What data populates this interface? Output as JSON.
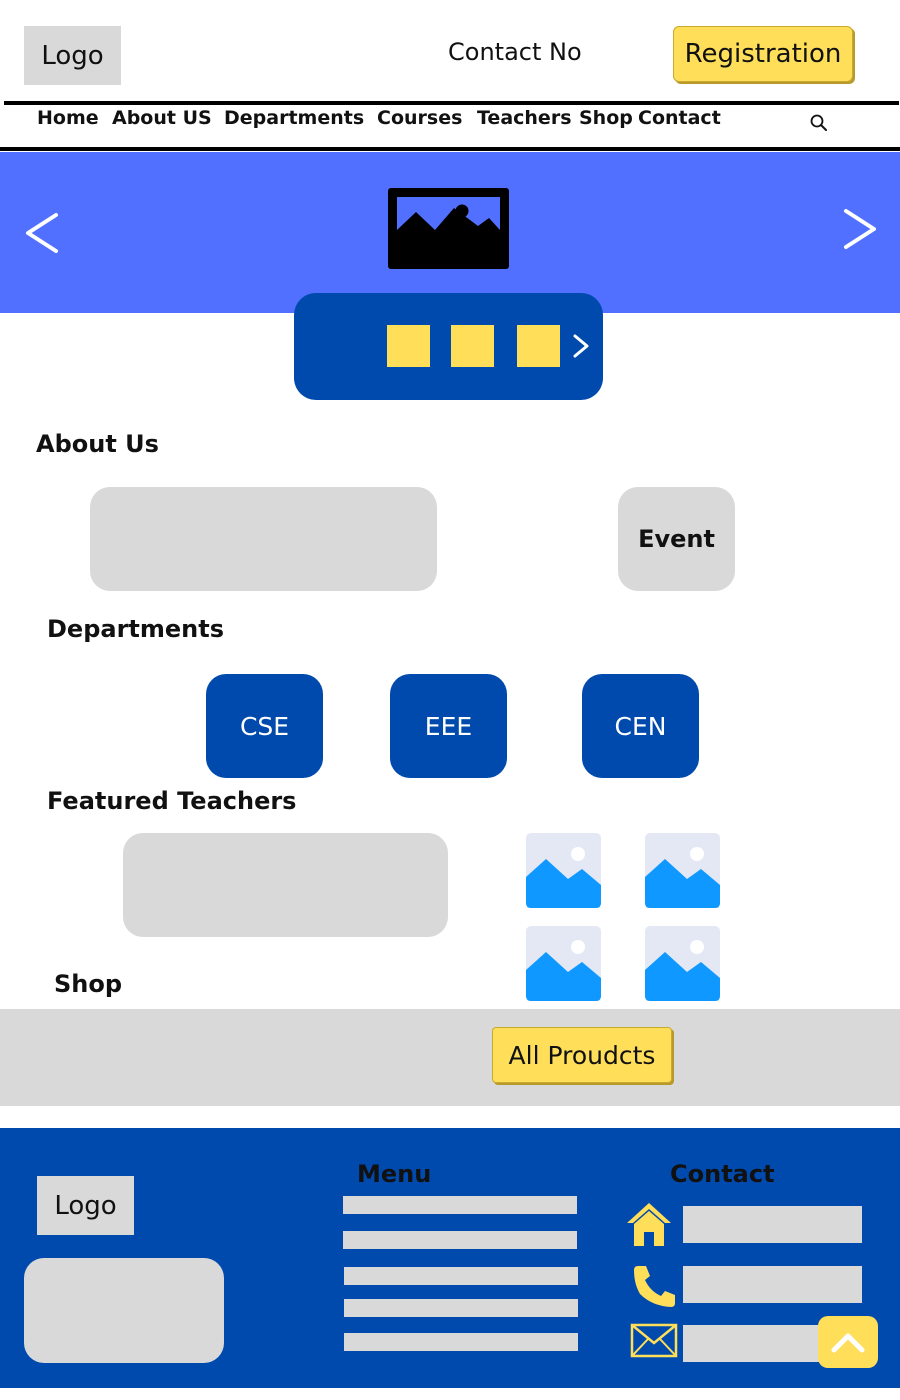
{
  "header": {
    "logo": "Logo",
    "contact_no": "Contact No",
    "registration_label": "Registration"
  },
  "nav": {
    "items": [
      {
        "label": "Home"
      },
      {
        "label": "About US"
      },
      {
        "label": "Departments"
      },
      {
        "label": "Courses"
      },
      {
        "label": "Teachers"
      },
      {
        "label": "Shop"
      },
      {
        "label": "Contact"
      }
    ],
    "search_icon": "search-icon"
  },
  "hero": {
    "prev_icon": "chevron-left-icon",
    "next_icon": "chevron-right-icon",
    "image_icon": "image-icon",
    "indicator_count": 3,
    "indicator_next_icon": "chevron-right-icon"
  },
  "about": {
    "heading": "About Us",
    "event_label": "Event"
  },
  "departments": {
    "heading": "Departments",
    "items": [
      {
        "label": "CSE"
      },
      {
        "label": "EEE"
      },
      {
        "label": "CEN"
      }
    ]
  },
  "teachers": {
    "heading": "Featured Teachers",
    "photo_icon": "image-icon"
  },
  "shop": {
    "heading": "Shop",
    "all_products_label": "All Proudcts"
  },
  "footer": {
    "logo": "Logo",
    "menu_heading": "Menu",
    "contact_heading": "Contact",
    "contact_icons": [
      "home-icon",
      "phone-icon",
      "mail-icon"
    ],
    "back_to_top_icon": "chevron-up-icon"
  },
  "colors": {
    "hero_blue": "#5170ff",
    "brand_blue": "#004aad",
    "accent_yellow": "#ffde59",
    "placeholder_gray": "#d9d9d9",
    "image_icon_blue": "#0f98ff"
  }
}
